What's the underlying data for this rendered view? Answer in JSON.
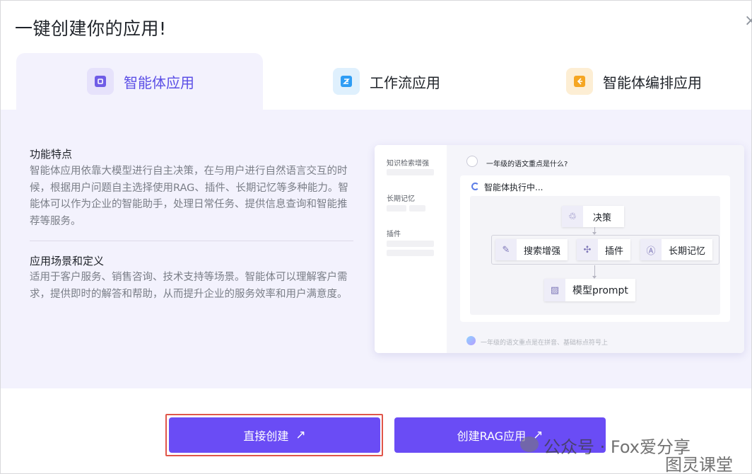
{
  "dialog": {
    "title": "一键创建你的应用!",
    "close": "×"
  },
  "tabs": [
    {
      "label": "智能体应用",
      "icon": "agent-app-icon",
      "color": "#6f5ce6",
      "bg": "#e6e2fb"
    },
    {
      "label": "工作流应用",
      "icon": "workflow-app-icon",
      "color": "#2f9df4",
      "bg": "#dff0fd"
    },
    {
      "label": "智能体编排应用",
      "icon": "agent-orchestration-icon",
      "color": "#f5a623",
      "bg": "#fdeed4"
    }
  ],
  "features": {
    "heading": "功能特点",
    "text": "智能体应用依靠大模型进行自主决策，在与用户进行自然语言交互的时候，根据用户问题自主选择使用RAG、插件、长期记忆等多种能力。智能体可以作为企业的智能助手，处理日常任务、提供信息查询和智能推荐等服务。"
  },
  "scenarios": {
    "heading": "应用场景和定义",
    "text": "适用于客户服务、销售咨询、技术支持等场景。智能体可以理解客户需求，提供即时的解答和帮助，从而提升企业的服务效率和用户满意度。"
  },
  "preview": {
    "side": [
      "知识检索增强",
      "长期记忆",
      "插件"
    ],
    "question": "一年级的语文重点是什么?",
    "status": "智能体执行中...",
    "nodes": {
      "decision": "决策",
      "search": "搜索增强",
      "plugin": "插件",
      "memory": "长期记忆",
      "model": "模型prompt"
    },
    "footer": "一年级的语文重点是在拼音、基础标点符号上"
  },
  "buttons": {
    "create_direct": "直接创建",
    "create_rag": "创建RAG应用",
    "arrow": "↗"
  },
  "watermark": {
    "line1": "公众号 · Fox爱分享",
    "line2": "图灵课堂"
  }
}
